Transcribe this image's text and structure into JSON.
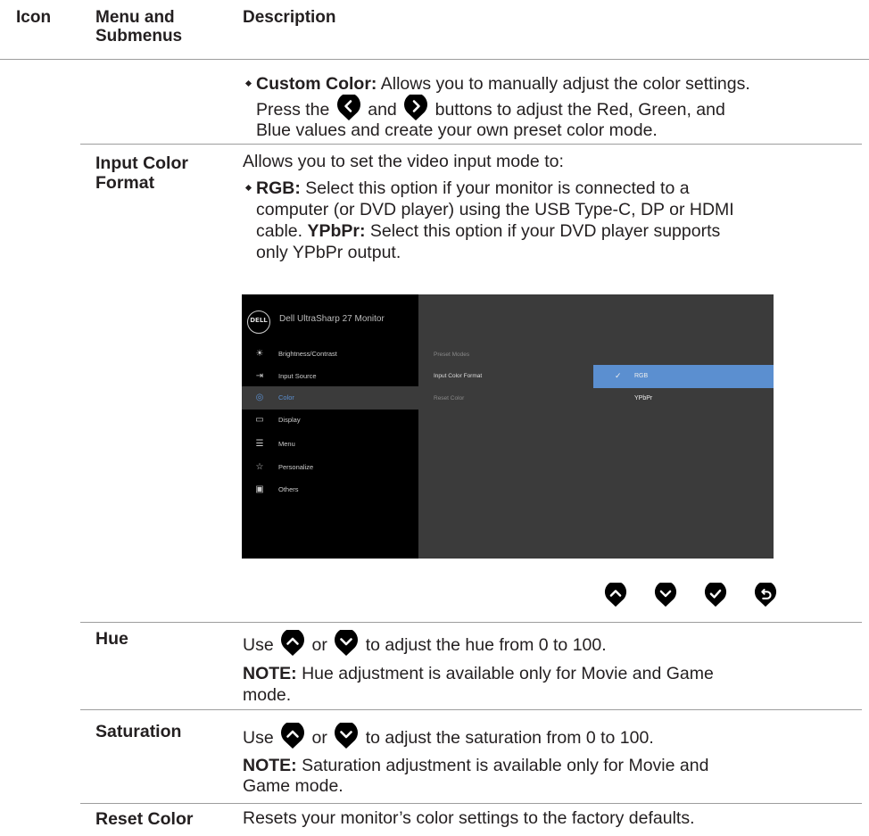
{
  "header": {
    "icon": "Icon",
    "menu": "Menu and Submenus",
    "description": "Description"
  },
  "custom_color": {
    "title": "Custom Color:",
    "text1": " Allows you to manually adjust the color settings.",
    "press": "Press the",
    "and": "and",
    "text2": "buttons to adjust the Red, Green, and",
    "text3": "Blue values and create your own preset color mode."
  },
  "input_color_format": {
    "label": "Input Color Format",
    "intro": "Allows you to set the video input mode to:",
    "rgb_title": "RGB:",
    "rgb_text": " Select this option if your monitor is connected to a",
    "rgb_text2": "computer (or DVD player) using the USB Type-C, DP or HDMI",
    "ypbpr_pre": "cable. ",
    "ypbpr_title": "YPbPr:",
    "ypbpr_text": " Select this option if your DVD player supports",
    "ypbpr_text2": "only YPbPr output."
  },
  "osd": {
    "logo": "DELL",
    "title": "Dell UltraSharp 27 Monitor",
    "menu": [
      {
        "label": "Brightness/Contrast",
        "icon": "sun-icon"
      },
      {
        "label": "Input Source",
        "icon": "input-icon"
      },
      {
        "label": "Color",
        "icon": "palette-icon",
        "selected": true
      },
      {
        "label": "Display",
        "icon": "monitor-icon"
      },
      {
        "label": "Menu",
        "icon": "menu-icon"
      },
      {
        "label": "Personalize",
        "icon": "star-icon"
      },
      {
        "label": "Others",
        "icon": "others-icon"
      }
    ],
    "submenu": [
      "Preset Modes",
      "Input Color Format",
      "Reset Color"
    ],
    "options": [
      {
        "label": "RGB",
        "selected": true
      },
      {
        "label": "YPbPr",
        "selected": false
      }
    ],
    "accent": "#5b8fd0"
  },
  "hue": {
    "label": "Hue",
    "use": "Use",
    "or": "or",
    "text": "to adjust the hue from 0 to 100.",
    "note_title": "NOTE:",
    "note": " Hue adjustment is available only for Movie and Game",
    "note2": "mode."
  },
  "saturation": {
    "label": "Saturation",
    "use": "Use",
    "or": "or",
    "text": "to adjust the saturation from 0 to 100.",
    "note_title": "NOTE:",
    "note": " Saturation adjustment is available only for Movie and",
    "note2": "Game mode."
  },
  "reset_color": {
    "label": "Reset Color",
    "text": "Resets your monitor’s color settings to the factory defaults."
  }
}
